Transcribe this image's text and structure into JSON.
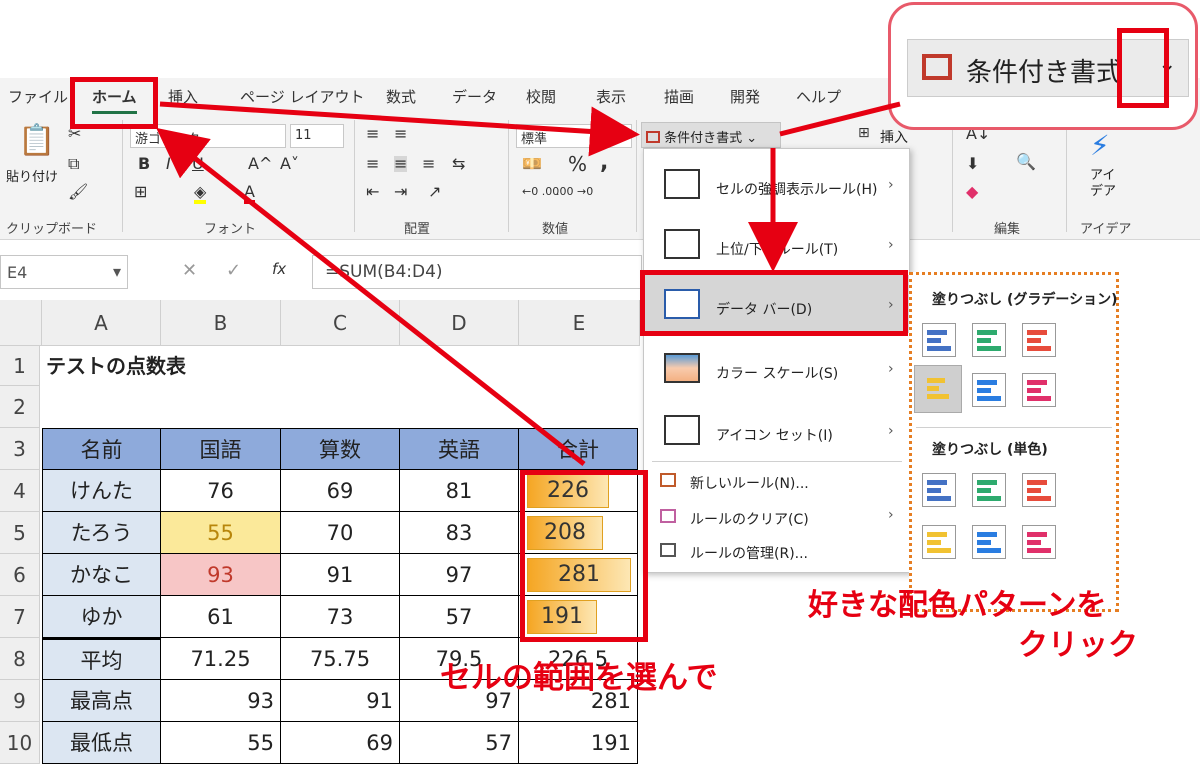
{
  "menu_tabs": [
    "ファイル",
    "ホーム",
    "挿入",
    "ページ レイアウト",
    "数式",
    "データ",
    "校閲",
    "表示",
    "描画",
    "開発",
    "ヘルプ"
  ],
  "ribbon": {
    "paste_label": "貼り付け",
    "font_name": "游ゴシック",
    "font_size": "11",
    "number_format": "標準",
    "cf_button": "条件付き書式",
    "insert_label": "挿入",
    "idea_label": "アイ\nデア",
    "groups": [
      "クリップボード",
      "フォント",
      "配置",
      "数値",
      "編集",
      "アイデア"
    ],
    "bold": "B",
    "italic": "I",
    "underline": "U",
    "grow": "A^",
    "shrink": "A˅",
    "percent": "%",
    "comma": ","
  },
  "formula_bar": {
    "name_box": "E4",
    "formula": "=SUM(B4:D4)",
    "fx": "fx"
  },
  "sheet": {
    "columns": [
      "A",
      "B",
      "C",
      "D",
      "E"
    ],
    "rows": [
      "1",
      "2",
      "3",
      "4",
      "5",
      "6",
      "7",
      "8",
      "9",
      "10"
    ],
    "title": "テストの点数表",
    "header": [
      "名前",
      "国語",
      "算数",
      "英語",
      "合計"
    ],
    "data": [
      [
        "けんた",
        "76",
        "69",
        "81",
        "226"
      ],
      [
        "たろう",
        "55",
        "70",
        "83",
        "208"
      ],
      [
        "かなこ",
        "93",
        "91",
        "97",
        "281"
      ],
      [
        "ゆか",
        "61",
        "73",
        "57",
        "191"
      ]
    ],
    "avg": [
      "平均",
      "71.25",
      "75.75",
      "79.5",
      "226.5"
    ],
    "max": [
      "最高点",
      "93",
      "91",
      "97",
      "281"
    ],
    "min": [
      "最低点",
      "55",
      "69",
      "57",
      "191"
    ],
    "totals_bar_fraction": [
      0.8,
      0.74,
      1.0,
      0.68
    ]
  },
  "cf_menu": {
    "items": [
      "セルの強調表示ルール(H)",
      "上位/下位ルール(T)",
      "データ バー(D)",
      "カラー スケール(S)",
      "アイコン セット(I)"
    ],
    "small_items": [
      "新しいルール(N)...",
      "ルールのクリア(C)",
      "ルールの管理(R)..."
    ]
  },
  "submenu": {
    "gradient_title": "塗りつぶし (グラデーション)",
    "solid_title": "塗りつぶし (単色)",
    "colors": [
      "#4472c4",
      "#2eaa6e",
      "#e74c3c",
      "#f1c232",
      "#2a7de1",
      "#e0306a"
    ]
  },
  "callout": {
    "label": "条件付き書式"
  },
  "annotations": {
    "select_range": "セルの範囲を選んで",
    "click_pattern_1": "好きな配色パターンを",
    "click_pattern_2": "クリック"
  },
  "colors": {
    "accent_red": "#e60012",
    "header_blue": "#8eaadb",
    "label_blue": "#dce6f2",
    "highlight_yellow": "#fbe99a",
    "highlight_red": "#f7c6c6"
  }
}
